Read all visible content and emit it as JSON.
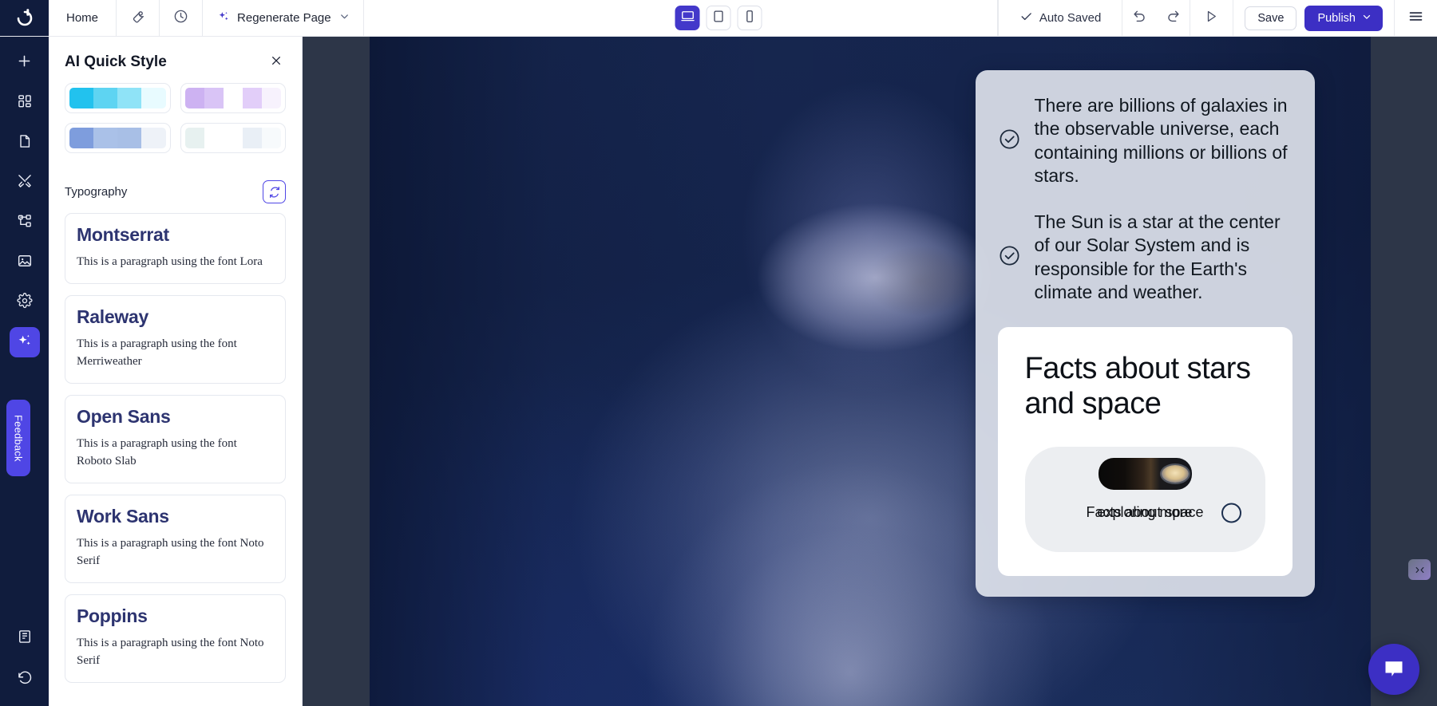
{
  "topbar": {
    "brand_icon": "dorik-logo-icon",
    "home_label": "Home",
    "wrench_icon": "wrench-icon",
    "history_icon": "clock-history-icon",
    "regenerate_label": "Regenerate Page",
    "regenerate_sparkle_icon": "sparkles-icon",
    "regenerate_chevron_icon": "chevron-down-icon",
    "viewport": {
      "desktop": {
        "icon": "desktop-icon",
        "active": true
      },
      "tablet": {
        "icon": "tablet-icon",
        "active": false
      },
      "mobile": {
        "icon": "mobile-icon",
        "active": false
      }
    },
    "autosave_label": "Auto Saved",
    "autosave_icon": "check-icon",
    "undo_icon": "undo-icon",
    "redo_icon": "redo-icon",
    "preview_icon": "play-icon",
    "save_label": "Save",
    "publish_label": "Publish",
    "publish_chevron_icon": "chevron-down-icon",
    "menu_icon": "hamburger-menu-icon"
  },
  "rail": {
    "items": [
      {
        "icon": "plus-icon",
        "name": "add-element",
        "active": false
      },
      {
        "icon": "grid-blocks-icon",
        "name": "blocks",
        "active": false
      },
      {
        "icon": "page-icon",
        "name": "pages",
        "active": false
      },
      {
        "icon": "crossed-tools-icon",
        "name": "tools",
        "active": false
      },
      {
        "icon": "sitemap-icon",
        "name": "sitemap",
        "active": false
      },
      {
        "icon": "image-icon",
        "name": "media",
        "active": false
      },
      {
        "icon": "gear-icon",
        "name": "settings",
        "active": false
      },
      {
        "icon": "sparkles-icon",
        "name": "ai-quick-style",
        "active": true
      }
    ],
    "feedback_label": "Feedback",
    "bottom_items": [
      {
        "icon": "book-icon",
        "name": "docs"
      },
      {
        "icon": "history-revert-icon",
        "name": "version-history"
      }
    ]
  },
  "panel": {
    "title": "AI Quick Style",
    "close_icon": "close-icon",
    "palettes": [
      {
        "name": "palette-cyan",
        "colors": [
          "#22c2ee",
          "#5ed4f2",
          "#8fe3f7",
          "#e8fbff"
        ]
      },
      {
        "name": "palette-lilac",
        "colors": [
          "#cdb2f2",
          "#d9c4f6",
          "#ffffff",
          "#e2cef9",
          "#f7f2fd"
        ]
      },
      {
        "name": "palette-blue",
        "colors": [
          "#7e9ddd",
          "#aac1e8",
          "#a8bfe6",
          "#eef2f8"
        ]
      },
      {
        "name": "palette-pale",
        "colors": [
          "#e7f1f0",
          "#ffffff",
          "#ffffff",
          "#e9eff6",
          "#f7fafc"
        ]
      }
    ],
    "typography_label": "Typography",
    "typography_refresh_icon": "refresh-icon",
    "fonts": [
      {
        "name": "Montserrat",
        "sample": "This is a paragraph using the font Lora"
      },
      {
        "name": "Raleway",
        "sample": "This is a paragraph using the font Merriweather"
      },
      {
        "name": "Open Sans",
        "sample": "This is a paragraph using the font Roboto Slab"
      },
      {
        "name": "Work Sans",
        "sample": "This is a paragraph using the font Noto Serif"
      },
      {
        "name": "Poppins",
        "sample": "This is a paragraph using the font Noto Serif"
      }
    ]
  },
  "canvas": {
    "facts": [
      {
        "check_icon": "check-circle-icon",
        "text": "There are billions of galaxies in the observable universe, each containing millions or billions of stars."
      },
      {
        "check_icon": "check-circle-icon",
        "text": "The Sun is a star at the center of our Solar System and is responsible for the Earth's climate and weather."
      }
    ],
    "inner_card": {
      "title": "Facts about stars and space",
      "carousel": {
        "slide_alt": "saturn-planet-image",
        "label_front": "Facts about space",
        "label_behind": "exploring more",
        "dot_name": "carousel-dot"
      }
    },
    "collapse_icon": "collapse-panel-icon",
    "chat_icon": "chat-bubble-icon"
  }
}
